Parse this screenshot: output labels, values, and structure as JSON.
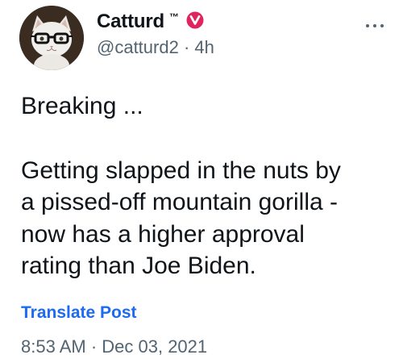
{
  "author": {
    "display_name": "Catturd",
    "trademark": "™",
    "handle": "@catturd2",
    "separator": " · ",
    "relative_time": "4h",
    "avatar": "cat-with-glasses-avatar",
    "badge_icon": "verified-badge-icon"
  },
  "tweet": {
    "paragraphs": [
      "Breaking ...",
      "Getting slapped in the nuts by\na pissed-off mountain gorilla -\nnow has a higher approval\nrating than Joe Biden."
    ]
  },
  "actions": {
    "translate_label": "Translate Post",
    "more_icon": "more-options-icon"
  },
  "timestamp": {
    "text": "8:53 AM · Dec 03, 2021"
  },
  "colors": {
    "text": "#0f1419",
    "secondary": "#536471",
    "link": "#1d6bf0",
    "badge": "#e0245e"
  }
}
